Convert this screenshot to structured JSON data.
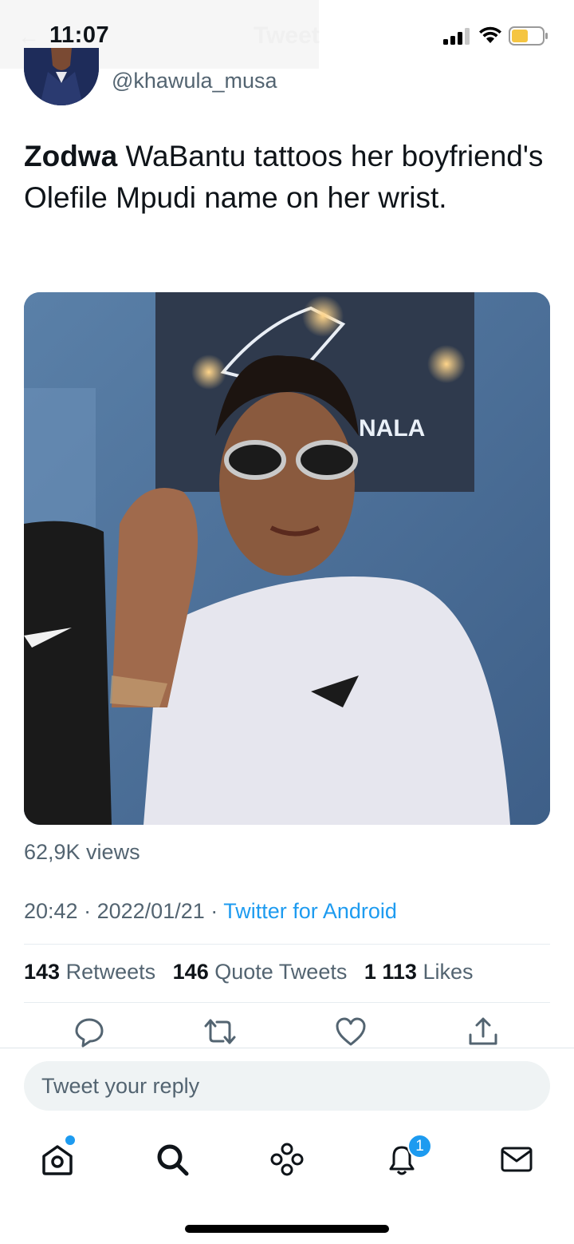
{
  "status": {
    "time": "11:07",
    "battery": "low-battery-yellow"
  },
  "header": {
    "title": "Tweet",
    "back_icon": "back-arrow-icon"
  },
  "tweet": {
    "handle": "@khawula_musa",
    "text_bold": "Zodwa",
    "text_rest": " WaBantu tattoos her boyfriend's Olefile Mpudi name on her wrist.",
    "views": "62,9K views",
    "time": "20:42",
    "date": "2022/01/21",
    "separator": "·",
    "source": "Twitter for Android",
    "retweets_count": "143",
    "retweets_label": "Retweets",
    "quotes_count": "146",
    "quotes_label": "Quote Tweets",
    "likes_count": "1 113",
    "likes_label": "Likes",
    "media_sign_text": "NALA"
  },
  "actions": [
    "reply-icon",
    "retweet-icon",
    "like-icon",
    "share-icon"
  ],
  "reply": {
    "placeholder": "Tweet your reply"
  },
  "tabbar": {
    "items": [
      "home-icon",
      "search-icon",
      "spaces-icon",
      "notifications-icon",
      "messages-icon"
    ],
    "notifications_badge": "1"
  },
  "colors": {
    "accent": "#1d9bf0",
    "secondary_text": "#536471",
    "primary_text": "#0f1419"
  }
}
